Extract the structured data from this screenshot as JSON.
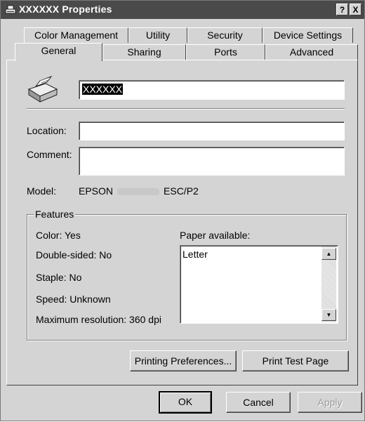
{
  "window": {
    "title": "XXXXXX Properties",
    "help_glyph": "?",
    "close_glyph": "X"
  },
  "tabs": {
    "row1": [
      "Color Management",
      "Utility",
      "Security",
      "Device Settings"
    ],
    "row2": [
      "General",
      "Sharing",
      "Ports",
      "Advanced"
    ],
    "active": "General"
  },
  "general": {
    "printer_name": "XXXXXX",
    "location_label": "Location:",
    "location_value": "",
    "comment_label": "Comment:",
    "comment_value": "",
    "model_label": "Model:",
    "model_prefix": "EPSON",
    "model_suffix": "ESC/P2"
  },
  "features": {
    "title": "Features",
    "color": "Color: Yes",
    "double_sided": "Double-sided: No",
    "staple": "Staple: No",
    "speed": "Speed: Unknown",
    "max_resolution": "Maximum resolution: 360 dpi",
    "paper_label": "Paper available:",
    "paper_items": [
      "Letter"
    ]
  },
  "buttons": {
    "printing_preferences": "Printing Preferences...",
    "print_test_page": "Print Test Page",
    "ok": "OK",
    "cancel": "Cancel",
    "apply": "Apply"
  },
  "icons": {
    "title": "printer-icon",
    "printer": "printer-icon",
    "scroll_up": "arrow-up-icon",
    "scroll_down": "arrow-down-icon"
  }
}
